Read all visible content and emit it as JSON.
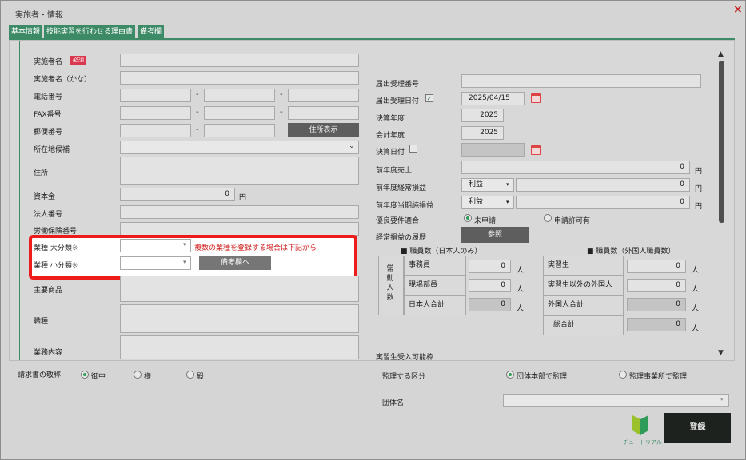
{
  "window": {
    "title": "実施者・情報",
    "close": "×"
  },
  "tabs": [
    "基本情報",
    "技能実習を行わせる理由書",
    "備考欄"
  ],
  "left": {
    "name": "実施者名",
    "required": "必須",
    "kana": "実施者名（かな）",
    "tel": "電話番号",
    "fax": "FAX番号",
    "postal": "郵便番号",
    "address_btn": "住所表示",
    "pref": "所在地候補",
    "address": "住所",
    "capital": "資本金",
    "capital_value": "0",
    "yen": "円",
    "corp_no": "法人番号",
    "labor_no": "労働保険番号",
    "industry_major": "業種 大分類",
    "industry_minor": "業種 小分類",
    "note_mark": "※",
    "multi_note": "複数の業種を登録する場合は下記から",
    "note_btn": "備考欄へ",
    "main_product": "主要商品",
    "position": "職種",
    "business": "業務内容",
    "dash": "-"
  },
  "right": {
    "accept_no": "届出受理番号",
    "accept_date": "届出受理日付",
    "accept_date_value": "2025/04/15",
    "fiscal_year": "決算年度",
    "fiscal_year_value": "2025",
    "account_year": "会計年度",
    "account_year_value": "2025",
    "settle_date": "決算日付",
    "prev_sales": "前年度売上",
    "prev_ordinary": "前年度経常損益",
    "prev_net": "前年度当期純損益",
    "profit": "利益",
    "zero": "0",
    "yen": "円",
    "excellent": "優良要件適合",
    "not_applied": "未申請",
    "applying": "申請許可有",
    "history": "経常損益の履歴",
    "ref_btn": "参照",
    "staff_jp_title": "■ 職員数（日本人のみ）",
    "staff_fx_title": "■ 職員数（外国人職員数）",
    "regular": "常勤人数",
    "office": "事務員",
    "field": "現場部員",
    "jp_total": "日本人合計",
    "trainee": "実習生",
    "foreign_other": "実習生以外の外国人",
    "foreign_total": "外国人合計",
    "grand_total": "総合計",
    "person": "人",
    "accept_possible": "実習生受入可能枠"
  },
  "bottom": {
    "honorific": "請求書の敬称",
    "h1": "御中",
    "h2": "様",
    "h3": "殿",
    "supervise": "監理する区分",
    "s1": "団体本部で監理",
    "s2": "監理事業所で監理",
    "org": "団体名",
    "tutorial": "チュートリアル",
    "register": "登録"
  }
}
